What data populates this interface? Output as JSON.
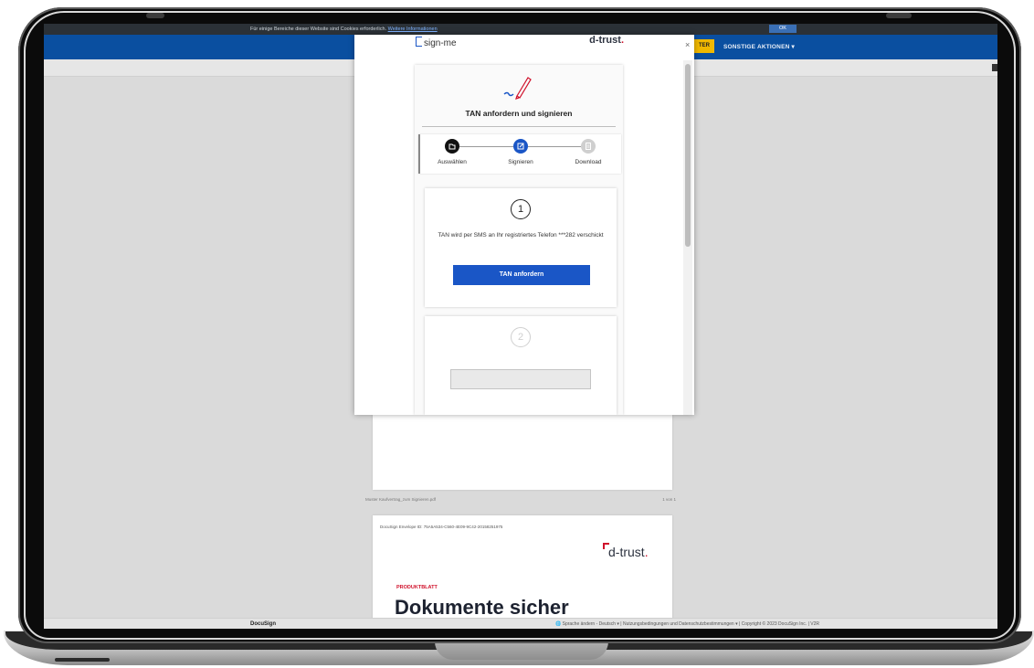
{
  "cookie_banner": {
    "text": "Für einige Bereiche dieser Website sind Cookies erforderlich.",
    "link": "Weitere Informationen",
    "ok_label": "OK"
  },
  "topbar": {
    "yellow_button_label": "TER",
    "more_actions_label": "SONSTIGE AKTIONEN ▾"
  },
  "modal": {
    "close_label": "×",
    "signme_logo": "sign-me",
    "dtrust_logo": "d-trust",
    "dtrust_logo_dot": ".",
    "card_title": "TAN anfordern und signieren",
    "steps": [
      {
        "label": "Auswählen"
      },
      {
        "label": "Signieren"
      },
      {
        "label": "Download"
      }
    ],
    "step1": {
      "number": "1",
      "info": "TAN wird per SMS an Ihr registriertes Telefon ***282 verschickt",
      "button_label": "TAN anfordern"
    },
    "step2": {
      "number": "2"
    }
  },
  "document": {
    "page_caption_left": "Muster Kaufvertrag_zum Signieren.pdf",
    "page_caption_right": "1 von 1",
    "envelope_id": "DocuSign Envelope ID: 75A5A534-C560-4E09-9C42-20158251975",
    "dtrust_logo": "d-trust",
    "dtrust_logo_dot": ".",
    "product_label": "PRODUKTBLATT",
    "headline": "Dokumente sicher"
  },
  "footer": {
    "brand": "DocuSign",
    "links": "🌐 Sprache ändern - Deutsch ▾  |  Nutzungsbedingungen und Datenschutzbestimmungen ▾  |  Copyright © 2023 DocuSign Inc. | V2R"
  },
  "colors": {
    "accent": "#1a56c6",
    "topbar": "#0a4fa0",
    "brand_red": "#d0112b"
  }
}
